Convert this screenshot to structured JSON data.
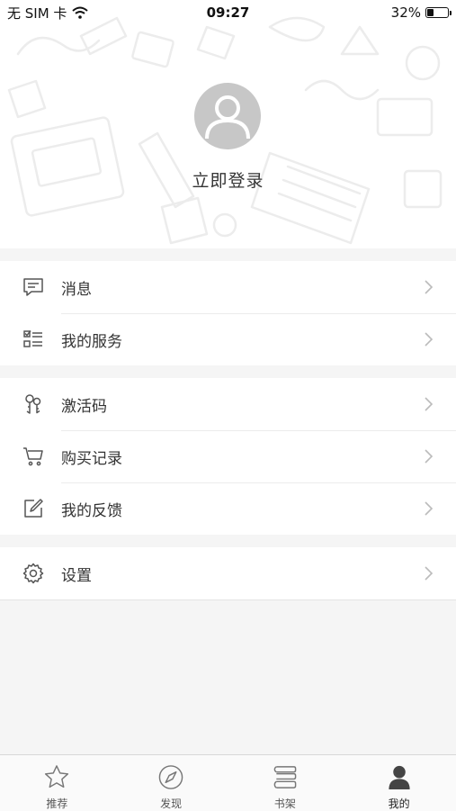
{
  "status_bar": {
    "carrier": "无 SIM 卡",
    "time": "09:27",
    "battery_text": "32%",
    "battery_level": 0.32
  },
  "profile": {
    "login_label": "立即登录"
  },
  "menu_groups": [
    [
      {
        "label": "消息",
        "icon": "message-icon"
      },
      {
        "label": "我的服务",
        "icon": "services-list-icon"
      }
    ],
    [
      {
        "label": "激活码",
        "icon": "key-icon"
      },
      {
        "label": "购买记录",
        "icon": "cart-icon"
      },
      {
        "label": "我的反馈",
        "icon": "edit-icon"
      }
    ],
    [
      {
        "label": "设置",
        "icon": "gear-icon"
      }
    ]
  ],
  "tabbar": {
    "items": [
      {
        "label": "推荐",
        "icon": "star-icon"
      },
      {
        "label": "发现",
        "icon": "compass-icon"
      },
      {
        "label": "书架",
        "icon": "bookshelf-icon"
      },
      {
        "label": "我的",
        "icon": "user-icon"
      }
    ],
    "active_index": 3
  }
}
